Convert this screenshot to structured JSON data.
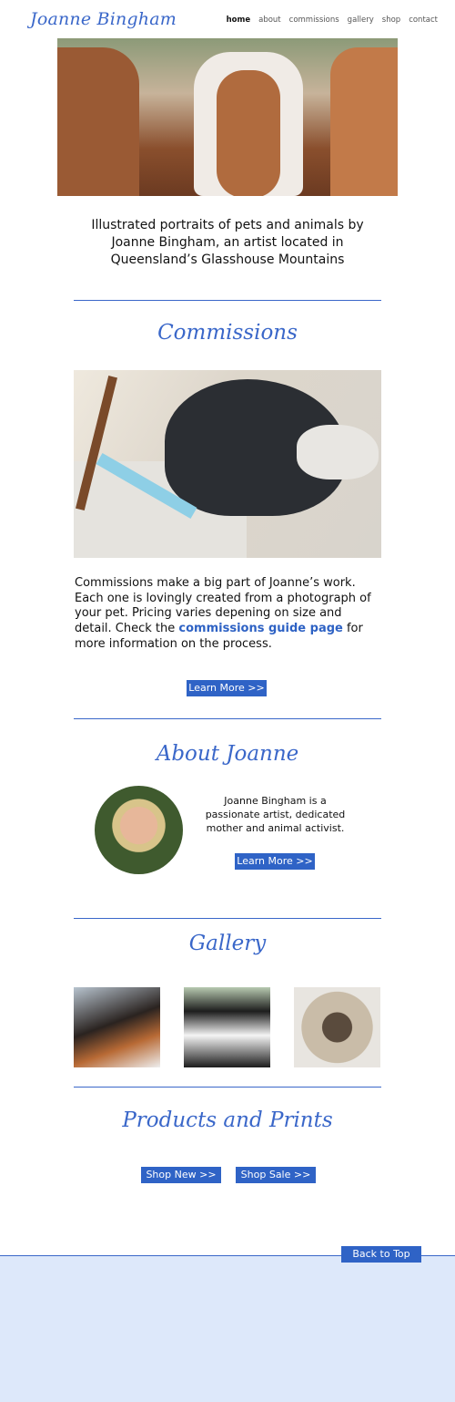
{
  "header": {
    "logo": "Joanne Bingham",
    "nav": [
      "home",
      "about",
      "commissions",
      "gallery",
      "shop",
      "contact"
    ]
  },
  "intro": "Illustrated portraits of pets and animals by Joanne Bingham, an artist located in Queensland’s Glasshouse Mountains",
  "commissions": {
    "heading": "Commissions",
    "text_before": "Commissions make a big part of Joanne’s work. Each one is lovingly created from a photograph of your pet. Pricing varies depening on size and detail. Check the ",
    "link": "commissions guide page",
    "text_after": " for more information on the process.",
    "button": "Learn More  >>"
  },
  "about": {
    "heading": "About Joanne",
    "text": "Joanne Bingham is a passionate artist, dedicated mother and animal activist.",
    "button": "Learn More  >>"
  },
  "gallery": {
    "heading": "Gallery"
  },
  "products": {
    "heading": "Products and Prints",
    "shop_new": "Shop New  >>",
    "shop_sale": "Shop Sale  >>"
  },
  "footer": {
    "back_to_top": "Back to Top"
  }
}
